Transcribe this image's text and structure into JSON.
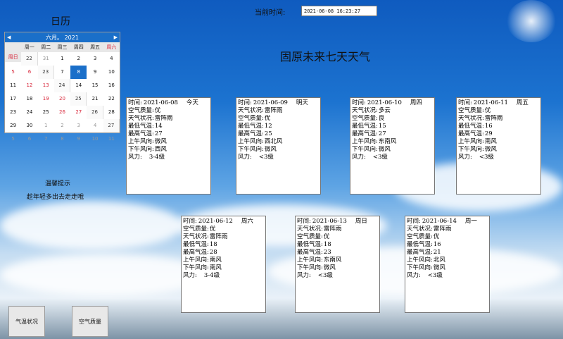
{
  "calendar": {
    "title": "日历",
    "month_label": "六月。 2021",
    "prev_arrow": "◀",
    "next_arrow": "▶",
    "weekdays": [
      "周一",
      "周二",
      "周三",
      "周四",
      "周五",
      "周六",
      "周日"
    ],
    "weeks": [
      {
        "wk": "22",
        "days": [
          "31",
          "1",
          "2",
          "3",
          "4",
          "5",
          "6"
        ]
      },
      {
        "wk": "23",
        "days": [
          "7",
          "8",
          "9",
          "10",
          "11",
          "12",
          "13"
        ]
      },
      {
        "wk": "24",
        "days": [
          "14",
          "15",
          "16",
          "17",
          "18",
          "19",
          "20"
        ]
      },
      {
        "wk": "25",
        "days": [
          "21",
          "22",
          "23",
          "24",
          "25",
          "26",
          "27"
        ]
      },
      {
        "wk": "26",
        "days": [
          "28",
          "29",
          "30",
          "1",
          "2",
          "3",
          "4"
        ]
      },
      {
        "wk": "27",
        "days": [
          "5",
          "6",
          "7",
          "8",
          "9",
          "10",
          "11"
        ]
      }
    ],
    "selected_day": "8"
  },
  "header": {
    "time_label": "当前时间:",
    "time_value": "2021-06-08 16:23:27",
    "page_title": "固原未来七天天气"
  },
  "labels": {
    "time": "时间:",
    "air": "空气质量:",
    "weather": "天气状况:",
    "low": "最低气温:",
    "high": "最高气温:",
    "am_wind": "上午风向:",
    "pm_wind": "下午风向:",
    "wind_force": "风力:"
  },
  "cards": [
    {
      "date": "2021-06-08",
      "day": "今天",
      "rows": [
        [
          "air",
          "优"
        ],
        [
          "weather",
          "雷阵雨"
        ],
        [
          "low",
          "14"
        ],
        [
          "high",
          "27"
        ],
        [
          "am_wind",
          "微风"
        ],
        [
          "pm_wind",
          "西风"
        ],
        [
          "wind_force",
          "3-4级"
        ]
      ]
    },
    {
      "date": "2021-06-09",
      "day": "明天",
      "rows": [
        [
          "weather",
          "雷阵雨"
        ],
        [
          "air",
          "优"
        ],
        [
          "low",
          "12"
        ],
        [
          "high",
          "25"
        ],
        [
          "am_wind",
          "西北风"
        ],
        [
          "pm_wind",
          "微风"
        ],
        [
          "wind_force",
          "<3级"
        ]
      ]
    },
    {
      "date": "2021-06-10",
      "day": "周四",
      "rows": [
        [
          "weather",
          "多云"
        ],
        [
          "air",
          "良"
        ],
        [
          "low",
          "15"
        ],
        [
          "high",
          "27"
        ],
        [
          "am_wind",
          "东南风"
        ],
        [
          "pm_wind",
          "微风"
        ],
        [
          "wind_force",
          "<3级"
        ]
      ]
    },
    {
      "date": "2021-06-11",
      "day": "周五",
      "rows": [
        [
          "air",
          "优"
        ],
        [
          "weather",
          "雷阵雨"
        ],
        [
          "low",
          "16"
        ],
        [
          "high",
          "29"
        ],
        [
          "am_wind",
          "南风"
        ],
        [
          "pm_wind",
          "微风"
        ],
        [
          "wind_force",
          "<3级"
        ]
      ]
    },
    {
      "date": "2021-06-12",
      "day": "周六",
      "rows": [
        [
          "air",
          "优"
        ],
        [
          "weather",
          "雷阵雨"
        ],
        [
          "low",
          "18"
        ],
        [
          "high",
          "28"
        ],
        [
          "am_wind",
          "南风"
        ],
        [
          "pm_wind",
          "南风"
        ],
        [
          "wind_force",
          "3-4级"
        ]
      ]
    },
    {
      "date": "2021-06-13",
      "day": "周日",
      "rows": [
        [
          "weather",
          "雷阵雨"
        ],
        [
          "air",
          "优"
        ],
        [
          "low",
          "18"
        ],
        [
          "high",
          "23"
        ],
        [
          "am_wind",
          "东南风"
        ],
        [
          "pm_wind",
          "微风"
        ],
        [
          "wind_force",
          "<3级"
        ]
      ]
    },
    {
      "date": "2021-06-14",
      "day": "周一",
      "rows": [
        [
          "weather",
          "雷阵雨"
        ],
        [
          "air",
          "优"
        ],
        [
          "low",
          "16"
        ],
        [
          "high",
          "21"
        ],
        [
          "am_wind",
          "北风"
        ],
        [
          "pm_wind",
          "微风"
        ],
        [
          "wind_force",
          "<3级"
        ]
      ]
    }
  ],
  "tips": {
    "title": "温馨提示",
    "text": "趁年轻多出去走走哦"
  },
  "buttons": {
    "temperature": "气温状况",
    "air_quality": "空气质量"
  },
  "colors": {
    "accent": "#1a6fc9",
    "weekend": "#d8263a"
  }
}
